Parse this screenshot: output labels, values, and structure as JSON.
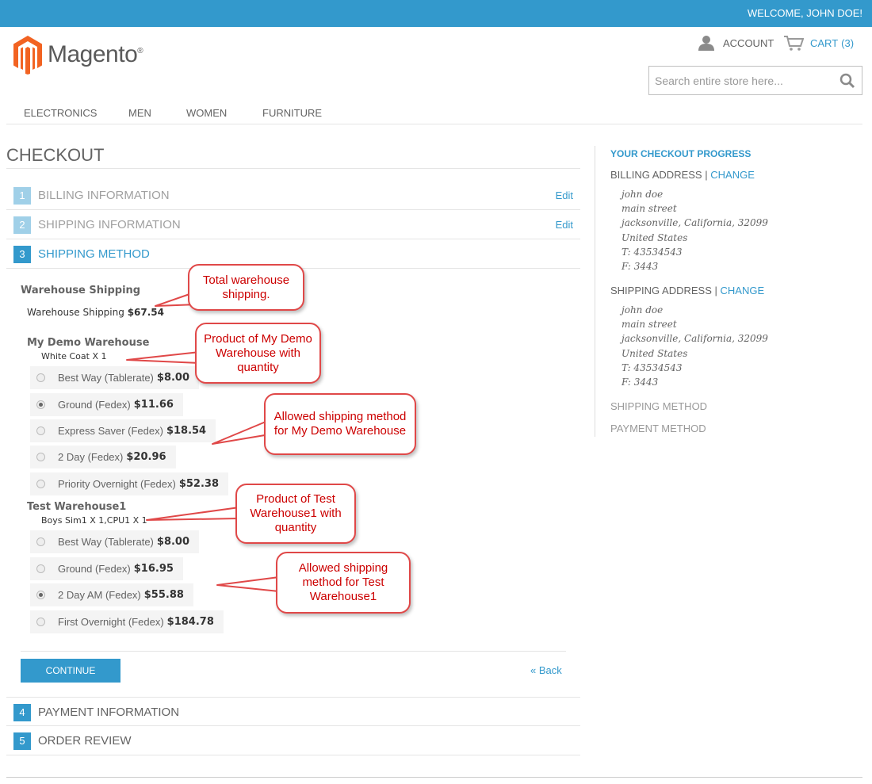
{
  "header": {
    "welcome": "WELCOME, JOHN DOE!",
    "brand": "Magento",
    "account_label": "ACCOUNT",
    "cart_label": "CART",
    "cart_count": "(3)",
    "search_placeholder": "Search entire store here..."
  },
  "nav": [
    "ELECTRONICS",
    "MEN",
    "WOMEN",
    "FURNITURE"
  ],
  "page_title": "CHECKOUT",
  "steps": [
    {
      "num": "1",
      "label": "BILLING INFORMATION",
      "edit": "Edit"
    },
    {
      "num": "2",
      "label": "SHIPPING INFORMATION",
      "edit": "Edit"
    },
    {
      "num": "3",
      "label": "SHIPPING METHOD"
    },
    {
      "num": "4",
      "label": "PAYMENT INFORMATION"
    },
    {
      "num": "5",
      "label": "ORDER REVIEW"
    }
  ],
  "shipping": {
    "heading": "Warehouse Shipping",
    "total_label": "Warehouse Shipping",
    "total_price": "$67.54",
    "warehouses": [
      {
        "name": "My Demo Warehouse",
        "products": "White Coat X 1",
        "options": [
          {
            "label": "Best Way (Tablerate)",
            "price": "$8.00",
            "selected": false
          },
          {
            "label": "Ground (Fedex)",
            "price": "$11.66",
            "selected": true
          },
          {
            "label": "Express Saver (Fedex)",
            "price": "$18.54",
            "selected": false
          },
          {
            "label": "2 Day (Fedex)",
            "price": "$20.96",
            "selected": false
          },
          {
            "label": "Priority Overnight (Fedex)",
            "price": "$52.38",
            "selected": false
          }
        ]
      },
      {
        "name": "Test Warehouse1",
        "products": "Boys Sim1 X 1,CPU1 X 1",
        "options": [
          {
            "label": "Best Way (Tablerate)",
            "price": "$8.00",
            "selected": false
          },
          {
            "label": "Ground (Fedex)",
            "price": "$16.95",
            "selected": false
          },
          {
            "label": "2 Day AM (Fedex)",
            "price": "$55.88",
            "selected": true
          },
          {
            "label": "First Overnight (Fedex)",
            "price": "$184.78",
            "selected": false
          }
        ]
      }
    ],
    "continue_label": "CONTINUE",
    "back_label": "« Back"
  },
  "sidebar": {
    "title": "YOUR CHECKOUT PROGRESS",
    "billing_head": "BILLING ADDRESS",
    "shipping_head": "SHIPPING ADDRESS",
    "change_label": "CHANGE",
    "separator": "|",
    "billing_address": [
      "john doe",
      "main street",
      "jacksonville, California, 32099",
      "United States",
      "T: 43534543",
      "F: 3443"
    ],
    "shipping_address": [
      "john doe",
      "main street",
      "jacksonville, California, 32099",
      "United States",
      "T: 43534543",
      "F: 3443"
    ],
    "shipping_method_head": "SHIPPING METHOD",
    "payment_method_head": "PAYMENT METHOD"
  },
  "annotations": [
    "Total warehouse shipping.",
    "Product of My Demo Warehouse with quantity",
    "Allowed shipping method for My Demo Warehouse",
    "Product of Test Warehouse1 with quantity",
    "Allowed shipping method for Test Warehouse1"
  ],
  "colors": {
    "accent": "#3399cc",
    "logo_orange": "#f26322",
    "callout_red": "#cc0000"
  }
}
